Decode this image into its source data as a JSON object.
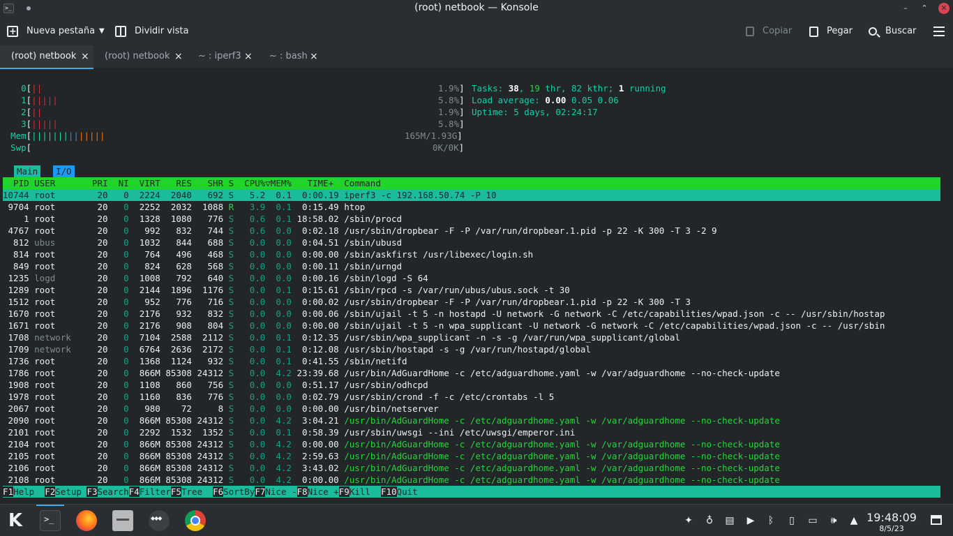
{
  "window": {
    "title": "(root) netbook — Konsole",
    "minimize": "–",
    "maximize": "⌃",
    "close": "✕"
  },
  "toolbar": {
    "new_tab": "Nueva pestaña",
    "split_view": "Dividir vista",
    "copy": "Copiar",
    "paste": "Pegar",
    "search": "Buscar"
  },
  "tabs": [
    {
      "label": "(root) netbook",
      "active": true
    },
    {
      "label": "(root) netbook",
      "active": false
    },
    {
      "label": "~ : iperf3",
      "active": false
    },
    {
      "label": "~ : bash",
      "active": false
    }
  ],
  "htop": {
    "cpu_rows": [
      {
        "label": "0",
        "bars": "||",
        "pct": "1.9%"
      },
      {
        "label": "1",
        "bars": "|||||",
        "pct": "5.8%"
      },
      {
        "label": "2",
        "bars": "||",
        "pct": "1.9%"
      },
      {
        "label": "3",
        "bars": "|||||",
        "pct": "5.8%"
      }
    ],
    "mem": {
      "label": "Mem",
      "value": "165M/1.93G"
    },
    "swp": {
      "label": "Swp",
      "value": "0K/0K"
    },
    "tasks_label": "Tasks: ",
    "tasks": "38",
    "thr": "19",
    "kthr": "82",
    "running": "1",
    "load_label": "Load average: ",
    "load1": "0.00",
    "load5": "0.05",
    "load15": "0.06",
    "uptime_label": "Uptime: ",
    "uptime": "5 days, 02:24:17",
    "screen_tabs": [
      "Main",
      "I/O"
    ],
    "columns": "  PID USER       PRI  NI  VIRT   RES   SHR S  CPU%▽MEM%   TIME+  Command",
    "processes": [
      {
        "pid": "10744",
        "user": "root",
        "pri": "20",
        "ni": "0",
        "virt": "2224",
        "res": "2040",
        "shr": "692",
        "s": "S",
        "cpu": "5.2",
        "mem": "0.1",
        "time": "0:00.19",
        "cmd": "iperf3 -c 192.168.50.74 -P 10"
      },
      {
        "pid": "9704",
        "user": "root",
        "pri": "20",
        "ni": "0",
        "virt": "2252",
        "res": "2032",
        "shr": "1088",
        "s": "R",
        "cpu": "3.9",
        "mem": "0.1",
        "time": "0:15.49",
        "cmd": "htop"
      },
      {
        "pid": "1",
        "user": "root",
        "pri": "20",
        "ni": "0",
        "virt": "1328",
        "res": "1080",
        "shr": "776",
        "s": "S",
        "cpu": "0.6",
        "mem": "0.1",
        "time": "18:58.02",
        "cmd": "/sbin/procd"
      },
      {
        "pid": "4767",
        "user": "root",
        "pri": "20",
        "ni": "0",
        "virt": "992",
        "res": "832",
        "shr": "744",
        "s": "S",
        "cpu": "0.6",
        "mem": "0.0",
        "time": "0:02.18",
        "cmd": "/usr/sbin/dropbear -F -P /var/run/dropbear.1.pid -p 22 -K 300 -T 3 -2 9"
      },
      {
        "pid": "812",
        "user": "ubus",
        "pri": "20",
        "ni": "0",
        "virt": "1032",
        "res": "844",
        "shr": "688",
        "s": "S",
        "cpu": "0.0",
        "mem": "0.0",
        "time": "0:04.51",
        "cmd": "/sbin/ubusd"
      },
      {
        "pid": "814",
        "user": "root",
        "pri": "20",
        "ni": "0",
        "virt": "764",
        "res": "496",
        "shr": "468",
        "s": "S",
        "cpu": "0.0",
        "mem": "0.0",
        "time": "0:00.00",
        "cmd": "/sbin/askfirst /usr/libexec/login.sh"
      },
      {
        "pid": "849",
        "user": "root",
        "pri": "20",
        "ni": "0",
        "virt": "824",
        "res": "628",
        "shr": "568",
        "s": "S",
        "cpu": "0.0",
        "mem": "0.0",
        "time": "0:00.11",
        "cmd": "/sbin/urngd"
      },
      {
        "pid": "1235",
        "user": "logd",
        "pri": "20",
        "ni": "0",
        "virt": "1008",
        "res": "792",
        "shr": "640",
        "s": "S",
        "cpu": "0.0",
        "mem": "0.0",
        "time": "0:00.16",
        "cmd": "/sbin/logd -S 64"
      },
      {
        "pid": "1289",
        "user": "root",
        "pri": "20",
        "ni": "0",
        "virt": "2144",
        "res": "1896",
        "shr": "1176",
        "s": "S",
        "cpu": "0.0",
        "mem": "0.1",
        "time": "0:15.61",
        "cmd": "/sbin/rpcd -s /var/run/ubus/ubus.sock -t 30"
      },
      {
        "pid": "1512",
        "user": "root",
        "pri": "20",
        "ni": "0",
        "virt": "952",
        "res": "776",
        "shr": "716",
        "s": "S",
        "cpu": "0.0",
        "mem": "0.0",
        "time": "0:00.02",
        "cmd": "/usr/sbin/dropbear -F -P /var/run/dropbear.1.pid -p 22 -K 300 -T 3"
      },
      {
        "pid": "1670",
        "user": "root",
        "pri": "20",
        "ni": "0",
        "virt": "2176",
        "res": "932",
        "shr": "832",
        "s": "S",
        "cpu": "0.0",
        "mem": "0.0",
        "time": "0:00.06",
        "cmd": "/sbin/ujail -t 5 -n hostapd -U network -G network -C /etc/capabilities/wpad.json -c -- /usr/sbin/hostap"
      },
      {
        "pid": "1671",
        "user": "root",
        "pri": "20",
        "ni": "0",
        "virt": "2176",
        "res": "908",
        "shr": "804",
        "s": "S",
        "cpu": "0.0",
        "mem": "0.0",
        "time": "0:00.00",
        "cmd": "/sbin/ujail -t 5 -n wpa_supplicant -U network -G network -C /etc/capabilities/wpad.json -c -- /usr/sbin"
      },
      {
        "pid": "1708",
        "user": "network",
        "pri": "20",
        "ni": "0",
        "virt": "7104",
        "res": "2588",
        "shr": "2112",
        "s": "S",
        "cpu": "0.0",
        "mem": "0.1",
        "time": "0:12.35",
        "cmd": "/usr/sbin/wpa_supplicant -n -s -g /var/run/wpa_supplicant/global"
      },
      {
        "pid": "1709",
        "user": "network",
        "pri": "20",
        "ni": "0",
        "virt": "6764",
        "res": "2636",
        "shr": "2172",
        "s": "S",
        "cpu": "0.0",
        "mem": "0.1",
        "time": "0:12.08",
        "cmd": "/usr/sbin/hostapd -s -g /var/run/hostapd/global"
      },
      {
        "pid": "1736",
        "user": "root",
        "pri": "20",
        "ni": "0",
        "virt": "1368",
        "res": "1124",
        "shr": "932",
        "s": "S",
        "cpu": "0.0",
        "mem": "0.1",
        "time": "0:41.55",
        "cmd": "/sbin/netifd"
      },
      {
        "pid": "1786",
        "user": "root",
        "pri": "20",
        "ni": "0",
        "virt": "866M",
        "res": "85308",
        "shr": "24312",
        "s": "S",
        "cpu": "0.0",
        "mem": "4.2",
        "time": "23:39.68",
        "cmd": "/usr/bin/AdGuardHome -c /etc/adguardhome.yaml -w /var/adguardhome --no-check-update"
      },
      {
        "pid": "1908",
        "user": "root",
        "pri": "20",
        "ni": "0",
        "virt": "1108",
        "res": "860",
        "shr": "756",
        "s": "S",
        "cpu": "0.0",
        "mem": "0.0",
        "time": "0:51.17",
        "cmd": "/usr/sbin/odhcpd"
      },
      {
        "pid": "1978",
        "user": "root",
        "pri": "20",
        "ni": "0",
        "virt": "1160",
        "res": "836",
        "shr": "776",
        "s": "S",
        "cpu": "0.0",
        "mem": "0.0",
        "time": "0:02.79",
        "cmd": "/usr/sbin/crond -f -c /etc/crontabs -l 5"
      },
      {
        "pid": "2067",
        "user": "root",
        "pri": "20",
        "ni": "0",
        "virt": "980",
        "res": "72",
        "shr": "8",
        "s": "S",
        "cpu": "0.0",
        "mem": "0.0",
        "time": "0:00.00",
        "cmd": "/usr/bin/netserver"
      },
      {
        "pid": "2090",
        "user": "root",
        "pri": "20",
        "ni": "0",
        "virt": "866M",
        "res": "85308",
        "shr": "24312",
        "s": "S",
        "cpu": "0.0",
        "mem": "4.2",
        "time": "3:04.21",
        "cmd": "/usr/bin/AdGuardHome -c /etc/adguardhome.yaml -w /var/adguardhome --no-check-update"
      },
      {
        "pid": "2101",
        "user": "root",
        "pri": "20",
        "ni": "0",
        "virt": "2292",
        "res": "1532",
        "shr": "1352",
        "s": "S",
        "cpu": "0.0",
        "mem": "0.1",
        "time": "0:58.39",
        "cmd": "/usr/sbin/uwsgi --ini /etc/uwsgi/emperor.ini"
      },
      {
        "pid": "2104",
        "user": "root",
        "pri": "20",
        "ni": "0",
        "virt": "866M",
        "res": "85308",
        "shr": "24312",
        "s": "S",
        "cpu": "0.0",
        "mem": "4.2",
        "time": "0:00.00",
        "cmd": "/usr/bin/AdGuardHome -c /etc/adguardhome.yaml -w /var/adguardhome --no-check-update"
      },
      {
        "pid": "2105",
        "user": "root",
        "pri": "20",
        "ni": "0",
        "virt": "866M",
        "res": "85308",
        "shr": "24312",
        "s": "S",
        "cpu": "0.0",
        "mem": "4.2",
        "time": "2:59.63",
        "cmd": "/usr/bin/AdGuardHome -c /etc/adguardhome.yaml -w /var/adguardhome --no-check-update"
      },
      {
        "pid": "2106",
        "user": "root",
        "pri": "20",
        "ni": "0",
        "virt": "866M",
        "res": "85308",
        "shr": "24312",
        "s": "S",
        "cpu": "0.0",
        "mem": "4.2",
        "time": "3:43.02",
        "cmd": "/usr/bin/AdGuardHome -c /etc/adguardhome.yaml -w /var/adguardhome --no-check-update"
      },
      {
        "pid": "2108",
        "user": "root",
        "pri": "20",
        "ni": "0",
        "virt": "866M",
        "res": "85308",
        "shr": "24312",
        "s": "S",
        "cpu": "0.0",
        "mem": "4.2",
        "time": "0:00.00",
        "cmd": "/usr/bin/AdGuardHome -c /etc/adguardhome.yaml -w /var/adguardhome --no-check-update"
      }
    ],
    "function_keys": [
      {
        "key": "F1",
        "label": "Help  "
      },
      {
        "key": "F2",
        "label": "Setup "
      },
      {
        "key": "F3",
        "label": "Search"
      },
      {
        "key": "F4",
        "label": "Filter"
      },
      {
        "key": "F5",
        "label": "Tree  "
      },
      {
        "key": "F6",
        "label": "SortBy"
      },
      {
        "key": "F7",
        "label": "Nice -"
      },
      {
        "key": "F8",
        "label": "Nice +"
      },
      {
        "key": "F9",
        "label": "Kill  "
      },
      {
        "key": "F10",
        "label": "Quit"
      }
    ]
  },
  "taskbar": {
    "apps": [
      "application-launcher-icon",
      "konsole-icon",
      "firefox-icon",
      "file-manager-icon",
      "tidal-icon",
      "chrome-icon"
    ],
    "clock_time": "19:48:09",
    "clock_date": "8/5/23"
  },
  "colors": {
    "header_bar": "#20d429",
    "selection": "#1abc9c",
    "accent": "#3daee9"
  }
}
